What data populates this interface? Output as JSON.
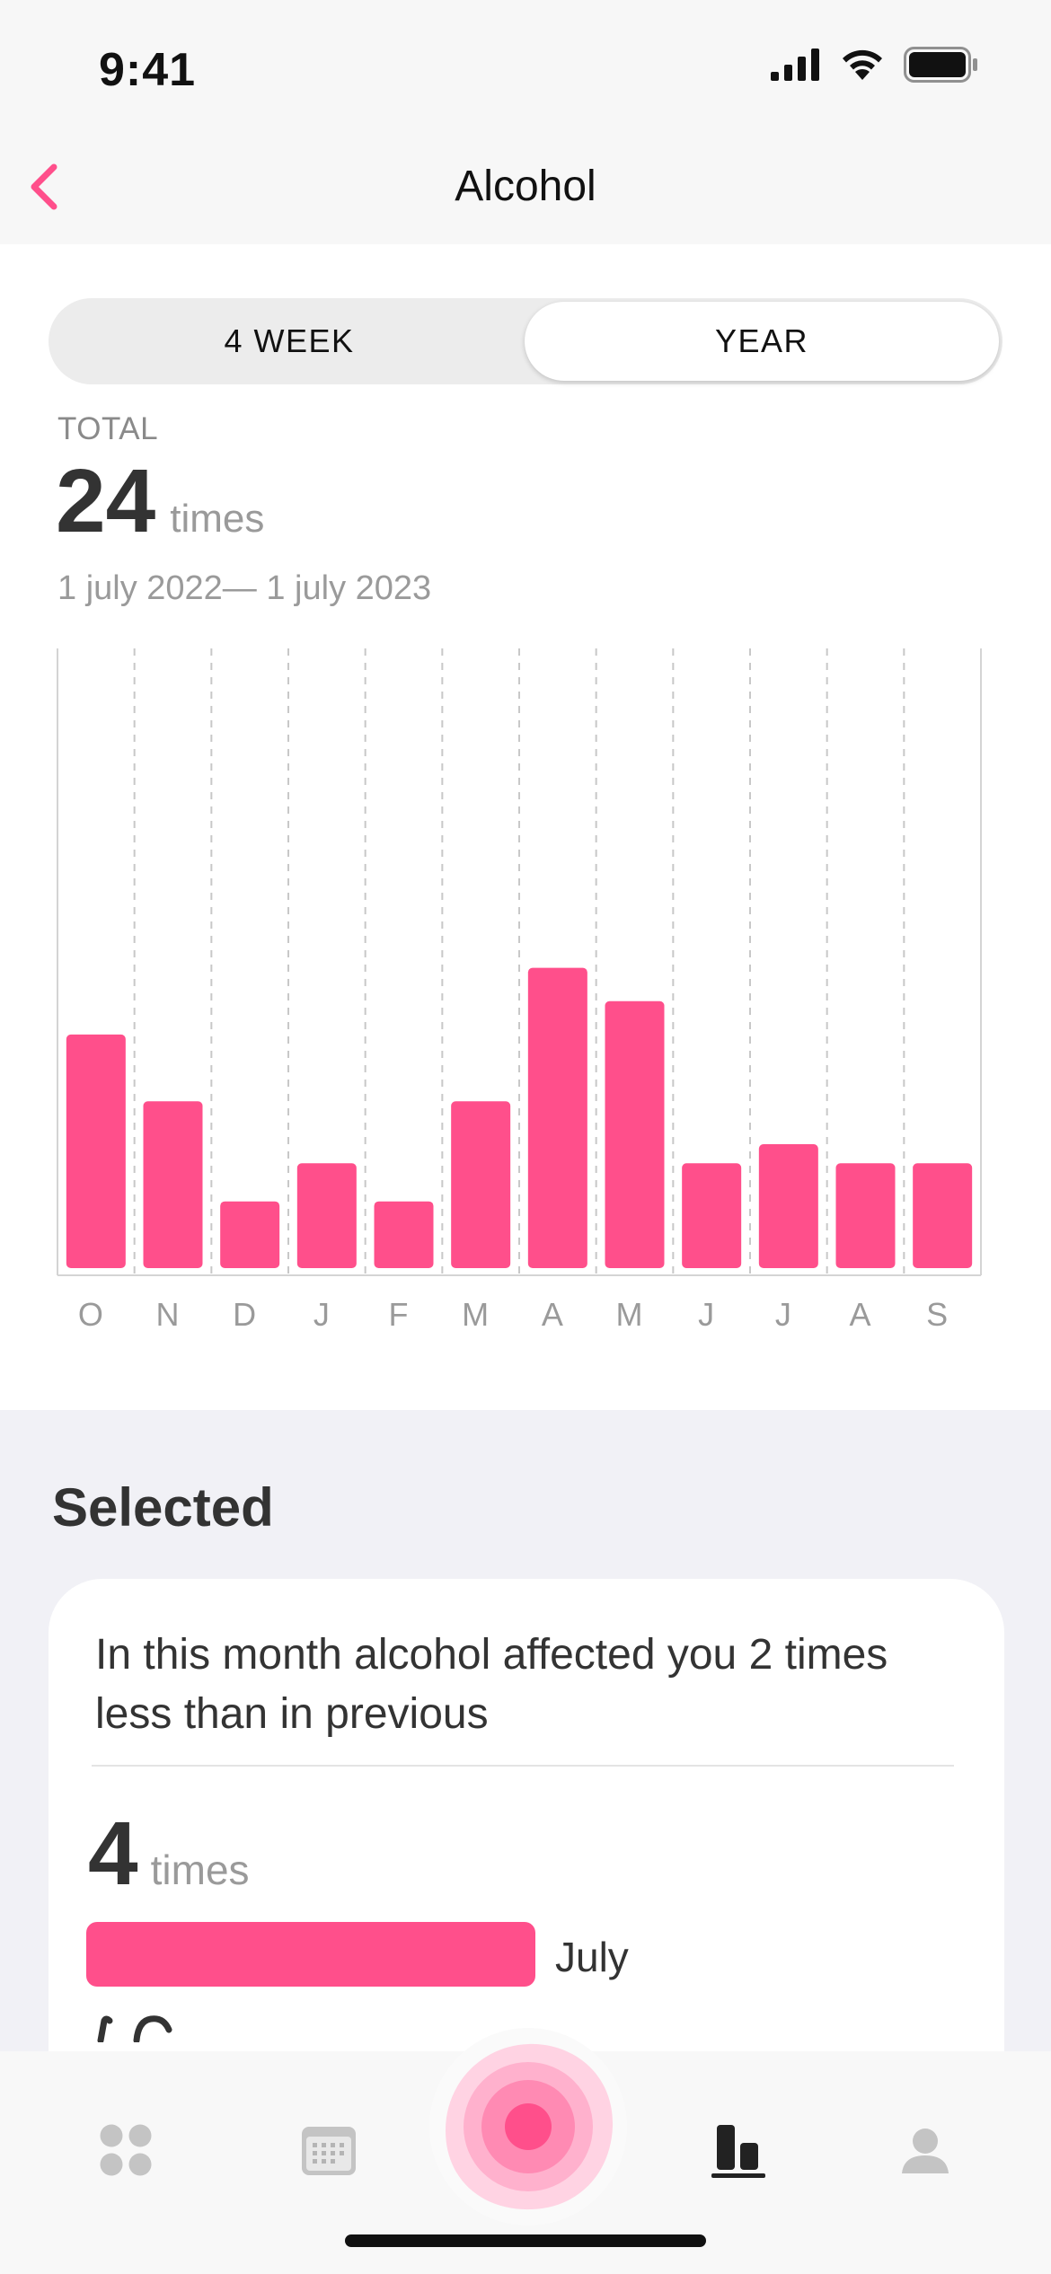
{
  "status_bar": {
    "time": "9:41"
  },
  "header": {
    "title": "Alcohol"
  },
  "period_toggle": {
    "options": [
      "4 WEEK",
      "YEAR"
    ],
    "selected": "YEAR"
  },
  "summary": {
    "label": "TOTAL",
    "value": "24",
    "unit": "times",
    "date_range": "1 july  2022— 1 july 2023"
  },
  "chart_data": {
    "type": "bar",
    "categories": [
      "O",
      "N",
      "D",
      "J",
      "F",
      "M",
      "A",
      "M",
      "J",
      "J",
      "A",
      "S"
    ],
    "values": [
      4.9,
      3.5,
      1.4,
      2.2,
      1.4,
      3.5,
      6.3,
      5.6,
      2.2,
      2.6,
      2.2,
      2.2
    ],
    "ylim": [
      0,
      13
    ],
    "grid": "vertical dashed",
    "bar_color": "#ff4f8b"
  },
  "selected": {
    "heading": "Selected",
    "message": "In this month alcohol affected you 2 times less than in previous",
    "value": "4",
    "unit": "times",
    "month": "July"
  },
  "colors": {
    "accent": "#ff4f8b",
    "back_arrow": "#ff4f8b"
  },
  "tab_bar": {
    "tabs": [
      {
        "icon": "dashboard-icon"
      },
      {
        "icon": "calendar-icon"
      },
      {
        "icon": "record-button-icon"
      },
      {
        "icon": "statistics-icon",
        "active": true
      },
      {
        "icon": "profile-icon"
      }
    ]
  }
}
